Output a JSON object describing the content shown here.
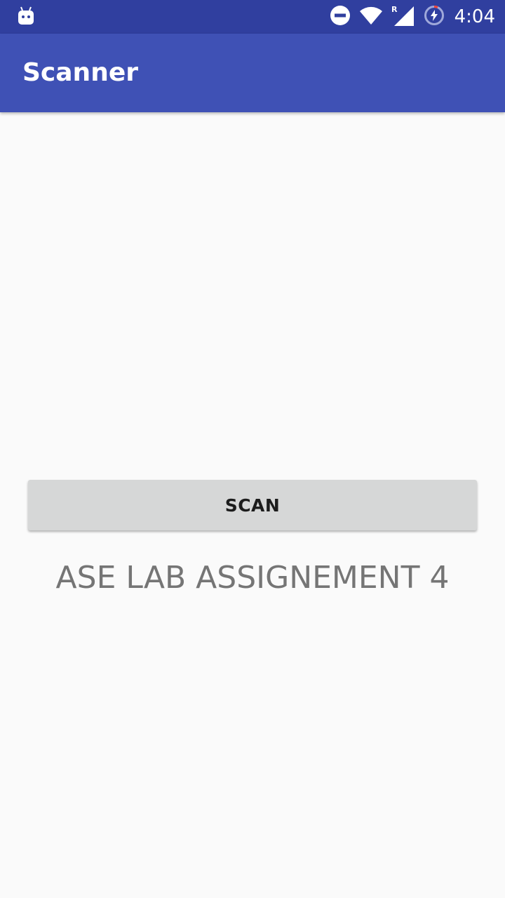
{
  "status_bar": {
    "time": "4:04",
    "icons": [
      "android-notification-icon",
      "do-not-disturb-icon",
      "wifi-icon",
      "roaming-signal-icon",
      "battery-charging-icon"
    ],
    "roaming_label": "R"
  },
  "app_bar": {
    "title": "Scanner"
  },
  "main": {
    "scan_button_label": "SCAN",
    "assignment_label": "ASE LAB ASSIGNEMENT 4"
  },
  "colors": {
    "status_bar": "#303f9f",
    "app_bar": "#3f51b5",
    "background": "#fafafa",
    "button": "#d6d7d7",
    "label_text": "#757575"
  }
}
